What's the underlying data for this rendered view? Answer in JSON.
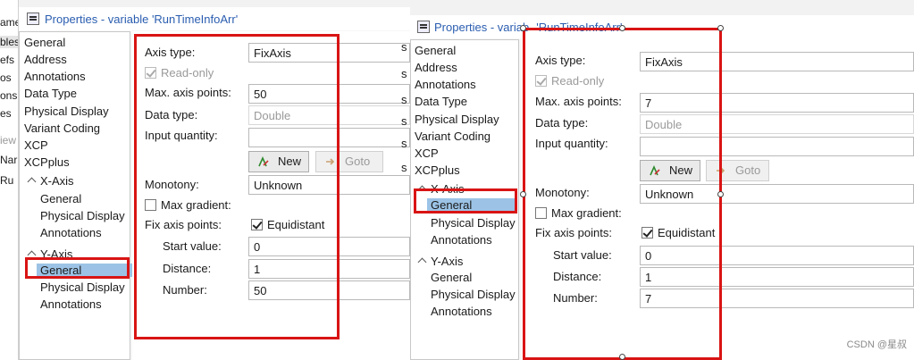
{
  "left_strip": {
    "items": [
      "ame",
      "bles",
      "efs",
      "os",
      "ons",
      "es",
      "iew",
      "Nar",
      "Ru"
    ]
  },
  "window1": {
    "title": "Properties - variable 'RunTimeInfoArr'",
    "nav": {
      "general": "General",
      "address": "Address",
      "annotations": "Annotations",
      "data_type": "Data Type",
      "physical_display": "Physical Display",
      "variant_coding": "Variant Coding",
      "xcp": "XCP",
      "xcpplus": "XCPplus",
      "x_axis": "X-Axis",
      "x_general": "General",
      "x_physical_display": "Physical Display",
      "x_annotations": "Annotations",
      "y_axis": "Y-Axis",
      "y_general": "General",
      "y_physical_display": "Physical Display",
      "y_annotations": "Annotations"
    },
    "form": {
      "axis_type_label": "Axis type:",
      "axis_type_value": "FixAxis",
      "read_only_label": "Read-only",
      "max_axis_points_label": "Max. axis points:",
      "max_axis_points_value": "50",
      "data_type_label": "Data type:",
      "data_type_value": "Double",
      "input_quantity_label": "Input quantity:",
      "input_quantity_value": "",
      "new_button": "New",
      "goto_button": "Goto",
      "monotony_label": "Monotony:",
      "monotony_value": "Unknown",
      "max_gradient_label": "Max gradient:",
      "fix_axis_points_label": "Fix axis points:",
      "equidistant_label": "Equidistant",
      "start_value_label": "Start value:",
      "start_value": "0",
      "distance_label": "Distance:",
      "distance_value": "1",
      "number_label": "Number:",
      "number_value": "50"
    }
  },
  "window2": {
    "title_part1": "Properties - variab",
    "title_part2": "'RunTimeInfoArr'",
    "nav": {
      "general": "General",
      "address": "Address",
      "annotations": "Annotations",
      "data_type": "Data Type",
      "physical_display": "Physical Display",
      "variant_coding": "Variant Coding",
      "xcp": "XCP",
      "xcpplus": "XCPplus",
      "x_axis": "X-Axis",
      "x_general": "General",
      "x_physical_display": "Physical Display",
      "x_annotations": "Annotations",
      "y_axis": "Y-Axis",
      "y_general": "General",
      "y_physical_display": "Physical Display",
      "y_annotations": "Annotations"
    },
    "form": {
      "axis_type_label": "Axis type:",
      "axis_type_value": "FixAxis",
      "read_only_label": "Read-only",
      "max_axis_points_label": "Max. axis points:",
      "max_axis_points_value": "7",
      "data_type_label": "Data type:",
      "data_type_value": "Double",
      "input_quantity_label": "Input quantity:",
      "input_quantity_value": "",
      "new_button": "New",
      "goto_button": "Goto",
      "monotony_label": "Monotony:",
      "monotony_value": "Unknown",
      "max_gradient_label": "Max gradient:",
      "fix_axis_points_label": "Fix axis points:",
      "equidistant_label": "Equidistant",
      "start_value_label": "Start value:",
      "start_value": "0",
      "distance_label": "Distance:",
      "distance_value": "1",
      "number_label": "Number:",
      "number_value": "7"
    }
  },
  "background_fragments": [
    "s",
    "s",
    "s",
    "s",
    "s",
    "s",
    "s",
    "s"
  ],
  "watermark": "CSDN @星叔",
  "colors": {
    "highlight_red": "#d91414",
    "selection_blue": "#9cc3e6",
    "title_blue": "#2a5db0"
  }
}
